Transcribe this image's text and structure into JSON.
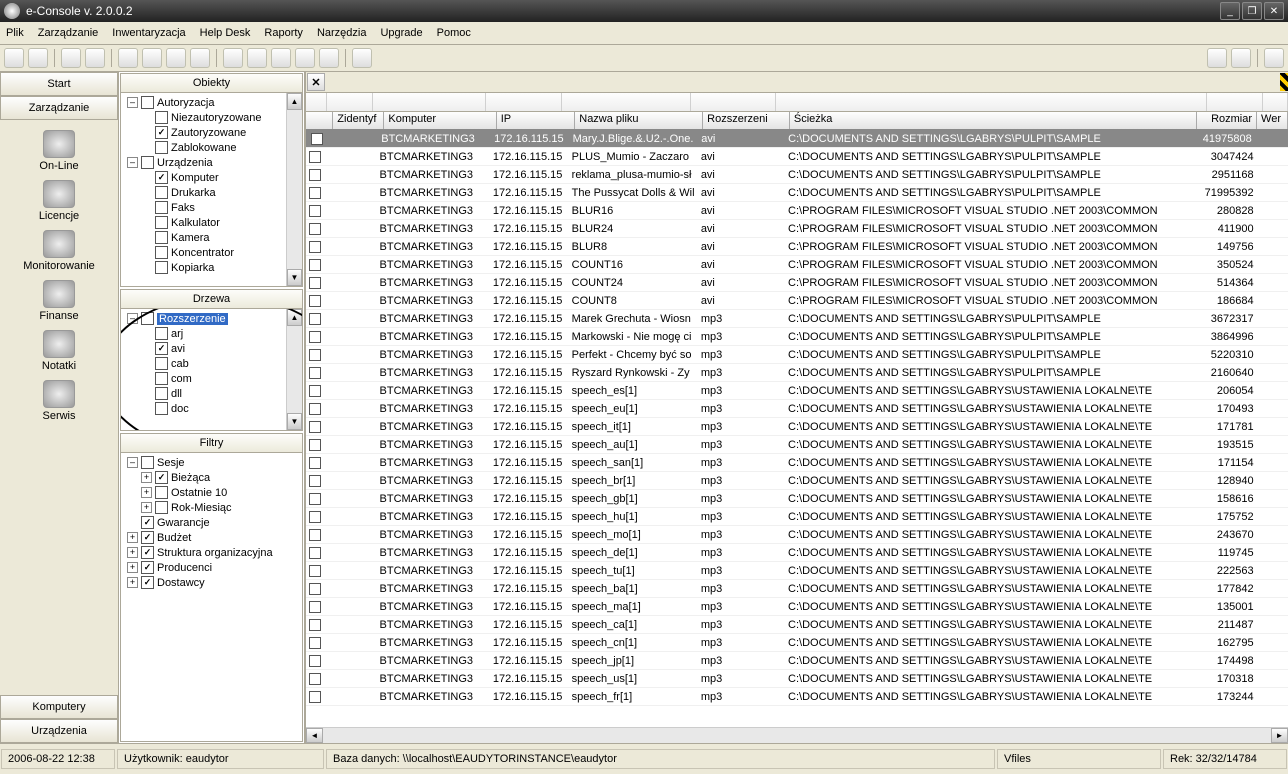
{
  "title": "e-Console v. 2.0.0.2",
  "menu": [
    "Plik",
    "Zarządzanie",
    "Inwentaryzacja",
    "Help Desk",
    "Raporty",
    "Narzędzia",
    "Upgrade",
    "Pomoc"
  ],
  "left": {
    "start": "Start",
    "zarz": "Zarządzanie",
    "komputery": "Komputery",
    "urzadzenia": "Urządzenia",
    "items": [
      {
        "label": "On-Line"
      },
      {
        "label": "Licencje"
      },
      {
        "label": "Monitorowanie"
      },
      {
        "label": "Finanse"
      },
      {
        "label": "Notatki"
      },
      {
        "label": "Serwis"
      }
    ]
  },
  "panels": {
    "obiekty": "Obiekty",
    "drzewa": "Drzewa",
    "filtry": "Filtry"
  },
  "obiekty": {
    "autoryzacja": {
      "label": "Autoryzacja",
      "children": [
        {
          "label": "Niezautoryzowane",
          "checked": false
        },
        {
          "label": "Zautoryzowane",
          "checked": true
        },
        {
          "label": "Zablokowane",
          "checked": false
        }
      ]
    },
    "urzadzenia": {
      "label": "Urządzenia",
      "children": [
        {
          "label": "Komputer",
          "checked": true
        },
        {
          "label": "Drukarka",
          "checked": false
        },
        {
          "label": "Faks",
          "checked": false
        },
        {
          "label": "Kalkulator",
          "checked": false
        },
        {
          "label": "Kamera",
          "checked": false
        },
        {
          "label": "Koncentrator",
          "checked": false
        },
        {
          "label": "Kopiarka",
          "checked": false
        }
      ]
    }
  },
  "drzewa": {
    "root": "Rozszerzenie",
    "items": [
      {
        "label": "arj",
        "checked": false
      },
      {
        "label": "avi",
        "checked": true
      },
      {
        "label": "cab",
        "checked": false
      },
      {
        "label": "com",
        "checked": false
      },
      {
        "label": "dll",
        "checked": false
      },
      {
        "label": "doc",
        "checked": false
      }
    ]
  },
  "filtry": {
    "sesje": {
      "label": "Sesje",
      "children": [
        {
          "label": "Bieżąca",
          "checked": true,
          "expand": "+"
        },
        {
          "label": "Ostatnie 10",
          "checked": false,
          "expand": "+"
        },
        {
          "label": "Rok-Miesiąc",
          "checked": false,
          "expand": "+"
        }
      ]
    },
    "others": [
      {
        "label": "Gwarancje",
        "checked": true,
        "expand": ""
      },
      {
        "label": "Budżet",
        "checked": true,
        "expand": "+"
      },
      {
        "label": "Struktura organizacyjna",
        "checked": true,
        "expand": "+"
      },
      {
        "label": "Producenci",
        "checked": true,
        "expand": "+"
      },
      {
        "label": "Dostawcy",
        "checked": true,
        "expand": "+"
      }
    ]
  },
  "grid": {
    "headers": {
      "id": "Zidentyf",
      "komp": "Komputer",
      "ip": "IP",
      "nazwa": "Nazwa pliku",
      "ext": "Rozszerzeni",
      "path": "Ścieżka",
      "size": "Rozmiar",
      "wer": "Wer"
    },
    "rows": [
      {
        "komp": "BTCMARKETING3",
        "ip": "172.16.115.15",
        "nazwa": "Mary.J.Blige.&.U2.-.One.",
        "ext": "avi",
        "path": "C:\\DOCUMENTS AND SETTINGS\\LGABRYS\\PULPIT\\SAMPLE",
        "size": "41975808",
        "sel": true
      },
      {
        "komp": "BTCMARKETING3",
        "ip": "172.16.115.15",
        "nazwa": "PLUS_Mumio - Zaczaro",
        "ext": "avi",
        "path": "C:\\DOCUMENTS AND SETTINGS\\LGABRYS\\PULPIT\\SAMPLE",
        "size": "3047424"
      },
      {
        "komp": "BTCMARKETING3",
        "ip": "172.16.115.15",
        "nazwa": "reklama_plusa-mumio-sł",
        "ext": "avi",
        "path": "C:\\DOCUMENTS AND SETTINGS\\LGABRYS\\PULPIT\\SAMPLE",
        "size": "2951168"
      },
      {
        "komp": "BTCMARKETING3",
        "ip": "172.16.115.15",
        "nazwa": "The Pussycat Dolls & Wil",
        "ext": "avi",
        "path": "C:\\DOCUMENTS AND SETTINGS\\LGABRYS\\PULPIT\\SAMPLE",
        "size": "71995392"
      },
      {
        "komp": "BTCMARKETING3",
        "ip": "172.16.115.15",
        "nazwa": "BLUR16",
        "ext": "avi",
        "path": "C:\\PROGRAM FILES\\MICROSOFT VISUAL STUDIO .NET 2003\\COMMON",
        "size": "280828"
      },
      {
        "komp": "BTCMARKETING3",
        "ip": "172.16.115.15",
        "nazwa": "BLUR24",
        "ext": "avi",
        "path": "C:\\PROGRAM FILES\\MICROSOFT VISUAL STUDIO .NET 2003\\COMMON",
        "size": "411900"
      },
      {
        "komp": "BTCMARKETING3",
        "ip": "172.16.115.15",
        "nazwa": "BLUR8",
        "ext": "avi",
        "path": "C:\\PROGRAM FILES\\MICROSOFT VISUAL STUDIO .NET 2003\\COMMON",
        "size": "149756"
      },
      {
        "komp": "BTCMARKETING3",
        "ip": "172.16.115.15",
        "nazwa": "COUNT16",
        "ext": "avi",
        "path": "C:\\PROGRAM FILES\\MICROSOFT VISUAL STUDIO .NET 2003\\COMMON",
        "size": "350524"
      },
      {
        "komp": "BTCMARKETING3",
        "ip": "172.16.115.15",
        "nazwa": "COUNT24",
        "ext": "avi",
        "path": "C:\\PROGRAM FILES\\MICROSOFT VISUAL STUDIO .NET 2003\\COMMON",
        "size": "514364"
      },
      {
        "komp": "BTCMARKETING3",
        "ip": "172.16.115.15",
        "nazwa": "COUNT8",
        "ext": "avi",
        "path": "C:\\PROGRAM FILES\\MICROSOFT VISUAL STUDIO .NET 2003\\COMMON",
        "size": "186684"
      },
      {
        "komp": "BTCMARKETING3",
        "ip": "172.16.115.15",
        "nazwa": "Marek Grechuta - Wiosn",
        "ext": "mp3",
        "path": "C:\\DOCUMENTS AND SETTINGS\\LGABRYS\\PULPIT\\SAMPLE",
        "size": "3672317"
      },
      {
        "komp": "BTCMARKETING3",
        "ip": "172.16.115.15",
        "nazwa": "Markowski - Nie mogę ci",
        "ext": "mp3",
        "path": "C:\\DOCUMENTS AND SETTINGS\\LGABRYS\\PULPIT\\SAMPLE",
        "size": "3864996"
      },
      {
        "komp": "BTCMARKETING3",
        "ip": "172.16.115.15",
        "nazwa": "Perfekt - Chcemy być so",
        "ext": "mp3",
        "path": "C:\\DOCUMENTS AND SETTINGS\\LGABRYS\\PULPIT\\SAMPLE",
        "size": "5220310"
      },
      {
        "komp": "BTCMARKETING3",
        "ip": "172.16.115.15",
        "nazwa": "Ryszard Rynkowski - Zy",
        "ext": "mp3",
        "path": "C:\\DOCUMENTS AND SETTINGS\\LGABRYS\\PULPIT\\SAMPLE",
        "size": "2160640"
      },
      {
        "komp": "BTCMARKETING3",
        "ip": "172.16.115.15",
        "nazwa": "speech_es[1]",
        "ext": "mp3",
        "path": "C:\\DOCUMENTS AND SETTINGS\\LGABRYS\\USTAWIENIA LOKALNE\\TE",
        "size": "206054"
      },
      {
        "komp": "BTCMARKETING3",
        "ip": "172.16.115.15",
        "nazwa": "speech_eu[1]",
        "ext": "mp3",
        "path": "C:\\DOCUMENTS AND SETTINGS\\LGABRYS\\USTAWIENIA LOKALNE\\TE",
        "size": "170493"
      },
      {
        "komp": "BTCMARKETING3",
        "ip": "172.16.115.15",
        "nazwa": "speech_it[1]",
        "ext": "mp3",
        "path": "C:\\DOCUMENTS AND SETTINGS\\LGABRYS\\USTAWIENIA LOKALNE\\TE",
        "size": "171781"
      },
      {
        "komp": "BTCMARKETING3",
        "ip": "172.16.115.15",
        "nazwa": "speech_au[1]",
        "ext": "mp3",
        "path": "C:\\DOCUMENTS AND SETTINGS\\LGABRYS\\USTAWIENIA LOKALNE\\TE",
        "size": "193515"
      },
      {
        "komp": "BTCMARKETING3",
        "ip": "172.16.115.15",
        "nazwa": "speech_san[1]",
        "ext": "mp3",
        "path": "C:\\DOCUMENTS AND SETTINGS\\LGABRYS\\USTAWIENIA LOKALNE\\TE",
        "size": "171154"
      },
      {
        "komp": "BTCMARKETING3",
        "ip": "172.16.115.15",
        "nazwa": "speech_br[1]",
        "ext": "mp3",
        "path": "C:\\DOCUMENTS AND SETTINGS\\LGABRYS\\USTAWIENIA LOKALNE\\TE",
        "size": "128940"
      },
      {
        "komp": "BTCMARKETING3",
        "ip": "172.16.115.15",
        "nazwa": "speech_gb[1]",
        "ext": "mp3",
        "path": "C:\\DOCUMENTS AND SETTINGS\\LGABRYS\\USTAWIENIA LOKALNE\\TE",
        "size": "158616"
      },
      {
        "komp": "BTCMARKETING3",
        "ip": "172.16.115.15",
        "nazwa": "speech_hu[1]",
        "ext": "mp3",
        "path": "C:\\DOCUMENTS AND SETTINGS\\LGABRYS\\USTAWIENIA LOKALNE\\TE",
        "size": "175752"
      },
      {
        "komp": "BTCMARKETING3",
        "ip": "172.16.115.15",
        "nazwa": "speech_mo[1]",
        "ext": "mp3",
        "path": "C:\\DOCUMENTS AND SETTINGS\\LGABRYS\\USTAWIENIA LOKALNE\\TE",
        "size": "243670"
      },
      {
        "komp": "BTCMARKETING3",
        "ip": "172.16.115.15",
        "nazwa": "speech_de[1]",
        "ext": "mp3",
        "path": "C:\\DOCUMENTS AND SETTINGS\\LGABRYS\\USTAWIENIA LOKALNE\\TE",
        "size": "119745"
      },
      {
        "komp": "BTCMARKETING3",
        "ip": "172.16.115.15",
        "nazwa": "speech_tu[1]",
        "ext": "mp3",
        "path": "C:\\DOCUMENTS AND SETTINGS\\LGABRYS\\USTAWIENIA LOKALNE\\TE",
        "size": "222563"
      },
      {
        "komp": "BTCMARKETING3",
        "ip": "172.16.115.15",
        "nazwa": "speech_ba[1]",
        "ext": "mp3",
        "path": "C:\\DOCUMENTS AND SETTINGS\\LGABRYS\\USTAWIENIA LOKALNE\\TE",
        "size": "177842"
      },
      {
        "komp": "BTCMARKETING3",
        "ip": "172.16.115.15",
        "nazwa": "speech_ma[1]",
        "ext": "mp3",
        "path": "C:\\DOCUMENTS AND SETTINGS\\LGABRYS\\USTAWIENIA LOKALNE\\TE",
        "size": "135001"
      },
      {
        "komp": "BTCMARKETING3",
        "ip": "172.16.115.15",
        "nazwa": "speech_ca[1]",
        "ext": "mp3",
        "path": "C:\\DOCUMENTS AND SETTINGS\\LGABRYS\\USTAWIENIA LOKALNE\\TE",
        "size": "211487"
      },
      {
        "komp": "BTCMARKETING3",
        "ip": "172.16.115.15",
        "nazwa": "speech_cn[1]",
        "ext": "mp3",
        "path": "C:\\DOCUMENTS AND SETTINGS\\LGABRYS\\USTAWIENIA LOKALNE\\TE",
        "size": "162795"
      },
      {
        "komp": "BTCMARKETING3",
        "ip": "172.16.115.15",
        "nazwa": "speech_jp[1]",
        "ext": "mp3",
        "path": "C:\\DOCUMENTS AND SETTINGS\\LGABRYS\\USTAWIENIA LOKALNE\\TE",
        "size": "174498"
      },
      {
        "komp": "BTCMARKETING3",
        "ip": "172.16.115.15",
        "nazwa": "speech_us[1]",
        "ext": "mp3",
        "path": "C:\\DOCUMENTS AND SETTINGS\\LGABRYS\\USTAWIENIA LOKALNE\\TE",
        "size": "170318"
      },
      {
        "komp": "BTCMARKETING3",
        "ip": "172.16.115.15",
        "nazwa": "speech_fr[1]",
        "ext": "mp3",
        "path": "C:\\DOCUMENTS AND SETTINGS\\LGABRYS\\USTAWIENIA LOKALNE\\TE",
        "size": "173244"
      }
    ]
  },
  "status": {
    "dt": "2006-08-22  12:38",
    "user": "Użytkownik: eaudytor",
    "db": "Baza danych: \\\\localhost\\EAUDYTORINSTANCE\\eaudytor",
    "vfiles": "Vfiles",
    "rek": "Rek: 32/32/14784"
  }
}
